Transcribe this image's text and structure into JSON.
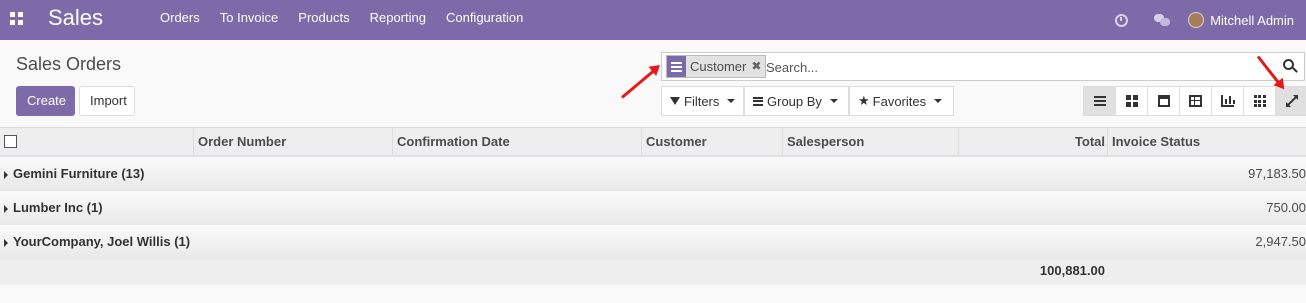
{
  "app": {
    "title": "Sales"
  },
  "nav": {
    "items": [
      "Orders",
      "To Invoice",
      "Products",
      "Reporting",
      "Configuration"
    ]
  },
  "user": {
    "name": "Mitchell Admin"
  },
  "page": {
    "breadcrumb": "Sales Orders"
  },
  "buttons": {
    "create": "Create",
    "import": "Import"
  },
  "search": {
    "facet": "Customer",
    "placeholder": "Search..."
  },
  "dropdowns": {
    "filters": "Filters",
    "group_by": "Group By",
    "favorites": "Favorites"
  },
  "table": {
    "headers": {
      "order_number": "Order Number",
      "confirmation_date": "Confirmation Date",
      "customer": "Customer",
      "salesperson": "Salesperson",
      "total": "Total",
      "invoice_status": "Invoice Status"
    },
    "groups": [
      {
        "name": "Gemini Furniture (13)",
        "total": "97,183.50"
      },
      {
        "name": "Lumber Inc (1)",
        "total": "750.00"
      },
      {
        "name": "YourCompany, Joel Willis (1)",
        "total": "2,947.50"
      }
    ],
    "grand_total": "100,881.00"
  },
  "colors": {
    "brand": "#7c6ba8",
    "annotation": "#e21a1a"
  },
  "icons": [
    "apps-icon",
    "clock-icon",
    "chat-icon",
    "avatar",
    "facet-groupby-icon",
    "close-icon",
    "search-icon",
    "filter-icon",
    "groupby-icon",
    "star-icon",
    "list-view-icon",
    "kanban-view-icon",
    "calendar-view-icon",
    "pivot-view-icon",
    "graph-view-icon",
    "dashboard-view-icon",
    "expand-icon"
  ]
}
